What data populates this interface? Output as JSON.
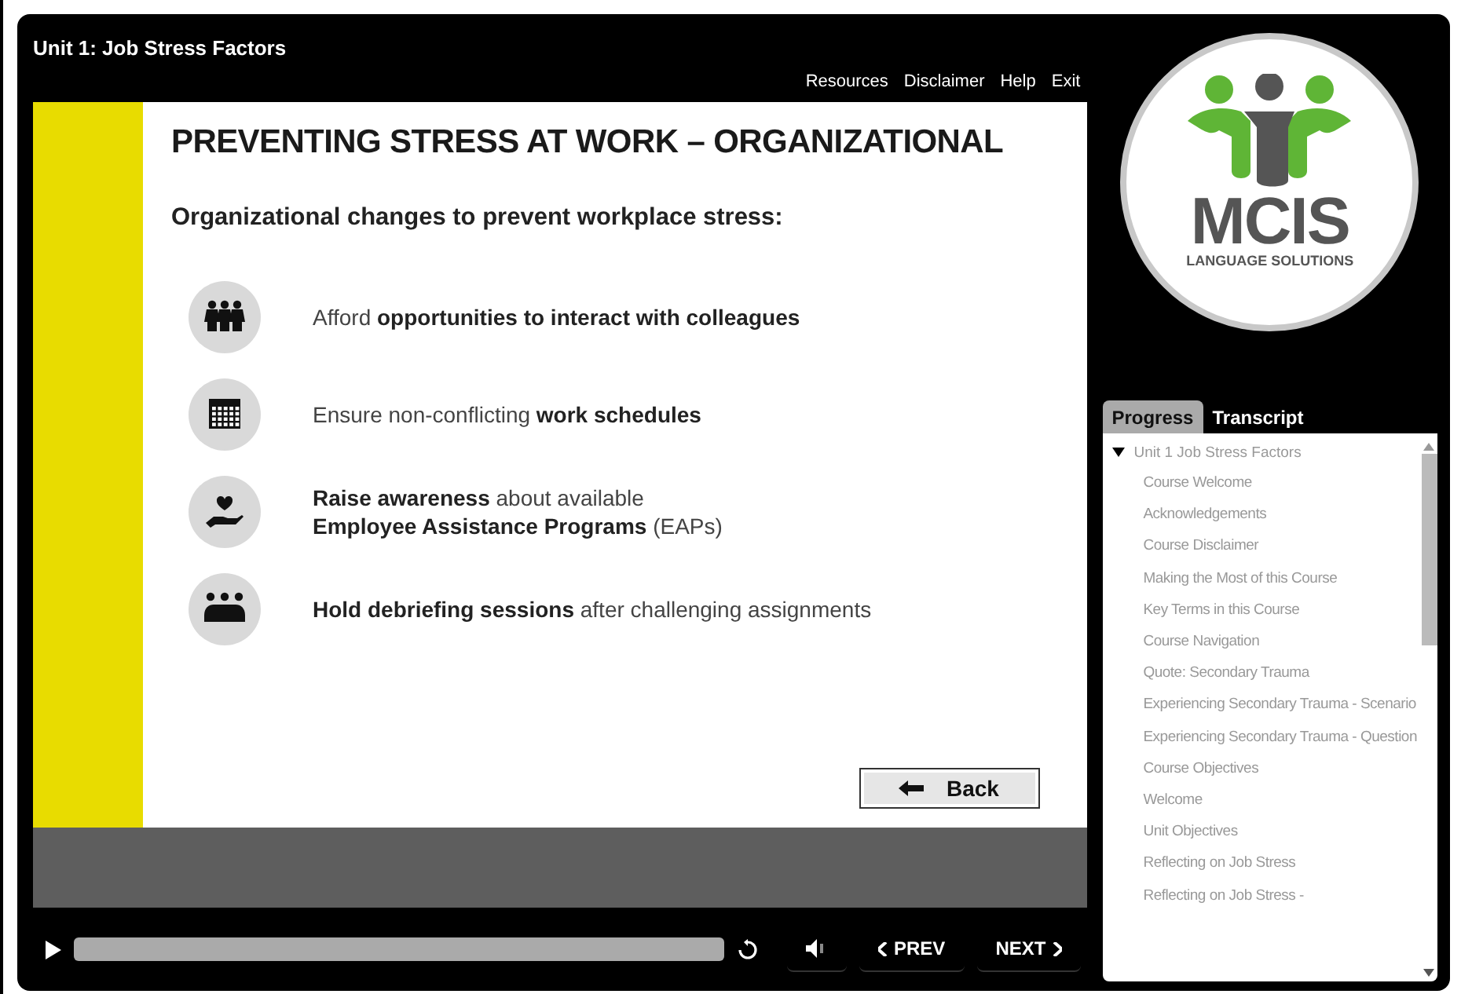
{
  "header": {
    "title": "Unit 1: Job Stress Factors",
    "links": [
      "Resources",
      "Disclaimer",
      "Help",
      "Exit"
    ]
  },
  "slide": {
    "heading": "PREVENTING STRESS AT WORK – ORGANIZATIONAL",
    "subheading": "Organizational changes to prevent workplace stress:",
    "bullets": [
      {
        "kind": "people",
        "lines": [
          "Afford **opportunities to interact with colleagues**"
        ]
      },
      {
        "kind": "calendar",
        "lines": [
          "Ensure non-conflicting **work schedules**"
        ]
      },
      {
        "kind": "care",
        "lines": [
          "**Raise awareness** about available",
          "**Employee Assistance Programs** (EAPs)"
        ]
      },
      {
        "kind": "meeting",
        "lines": [
          "**Hold debriefing sessions** after challenging assignments"
        ]
      }
    ],
    "back_button": "Back"
  },
  "player": {
    "prev": "PREV",
    "next": "NEXT"
  },
  "logo": {
    "name": "MCIS",
    "tagline": "LANGUAGE SOLUTIONS"
  },
  "tabs": [
    {
      "label": "Progress",
      "selected": true
    },
    {
      "label": "Transcript",
      "selected": false
    }
  ],
  "progress": [
    {
      "label": "Unit 1 Job Stress Factors",
      "expanded": true,
      "children": [
        {
          "label": "Course Welcome"
        },
        {
          "label": "Acknowledgements"
        },
        {
          "label": "Course Disclaimer"
        },
        {
          "label": "Making the Most of this Course"
        },
        {
          "label": "Key Terms in this Course"
        },
        {
          "label": "Course Navigation"
        },
        {
          "label": "Quote: Secondary Trauma"
        },
        {
          "label": "Experiencing Secondary Trauma - Scenario"
        },
        {
          "label": "Experiencing Secondary Trauma - Question"
        },
        {
          "label": "Course Objectives"
        },
        {
          "label": "Welcome"
        },
        {
          "label": "Unit Objectives"
        },
        {
          "label": "Reflecting on Job Stress"
        },
        {
          "label": "Reflecting on Job Stress -"
        }
      ]
    }
  ]
}
